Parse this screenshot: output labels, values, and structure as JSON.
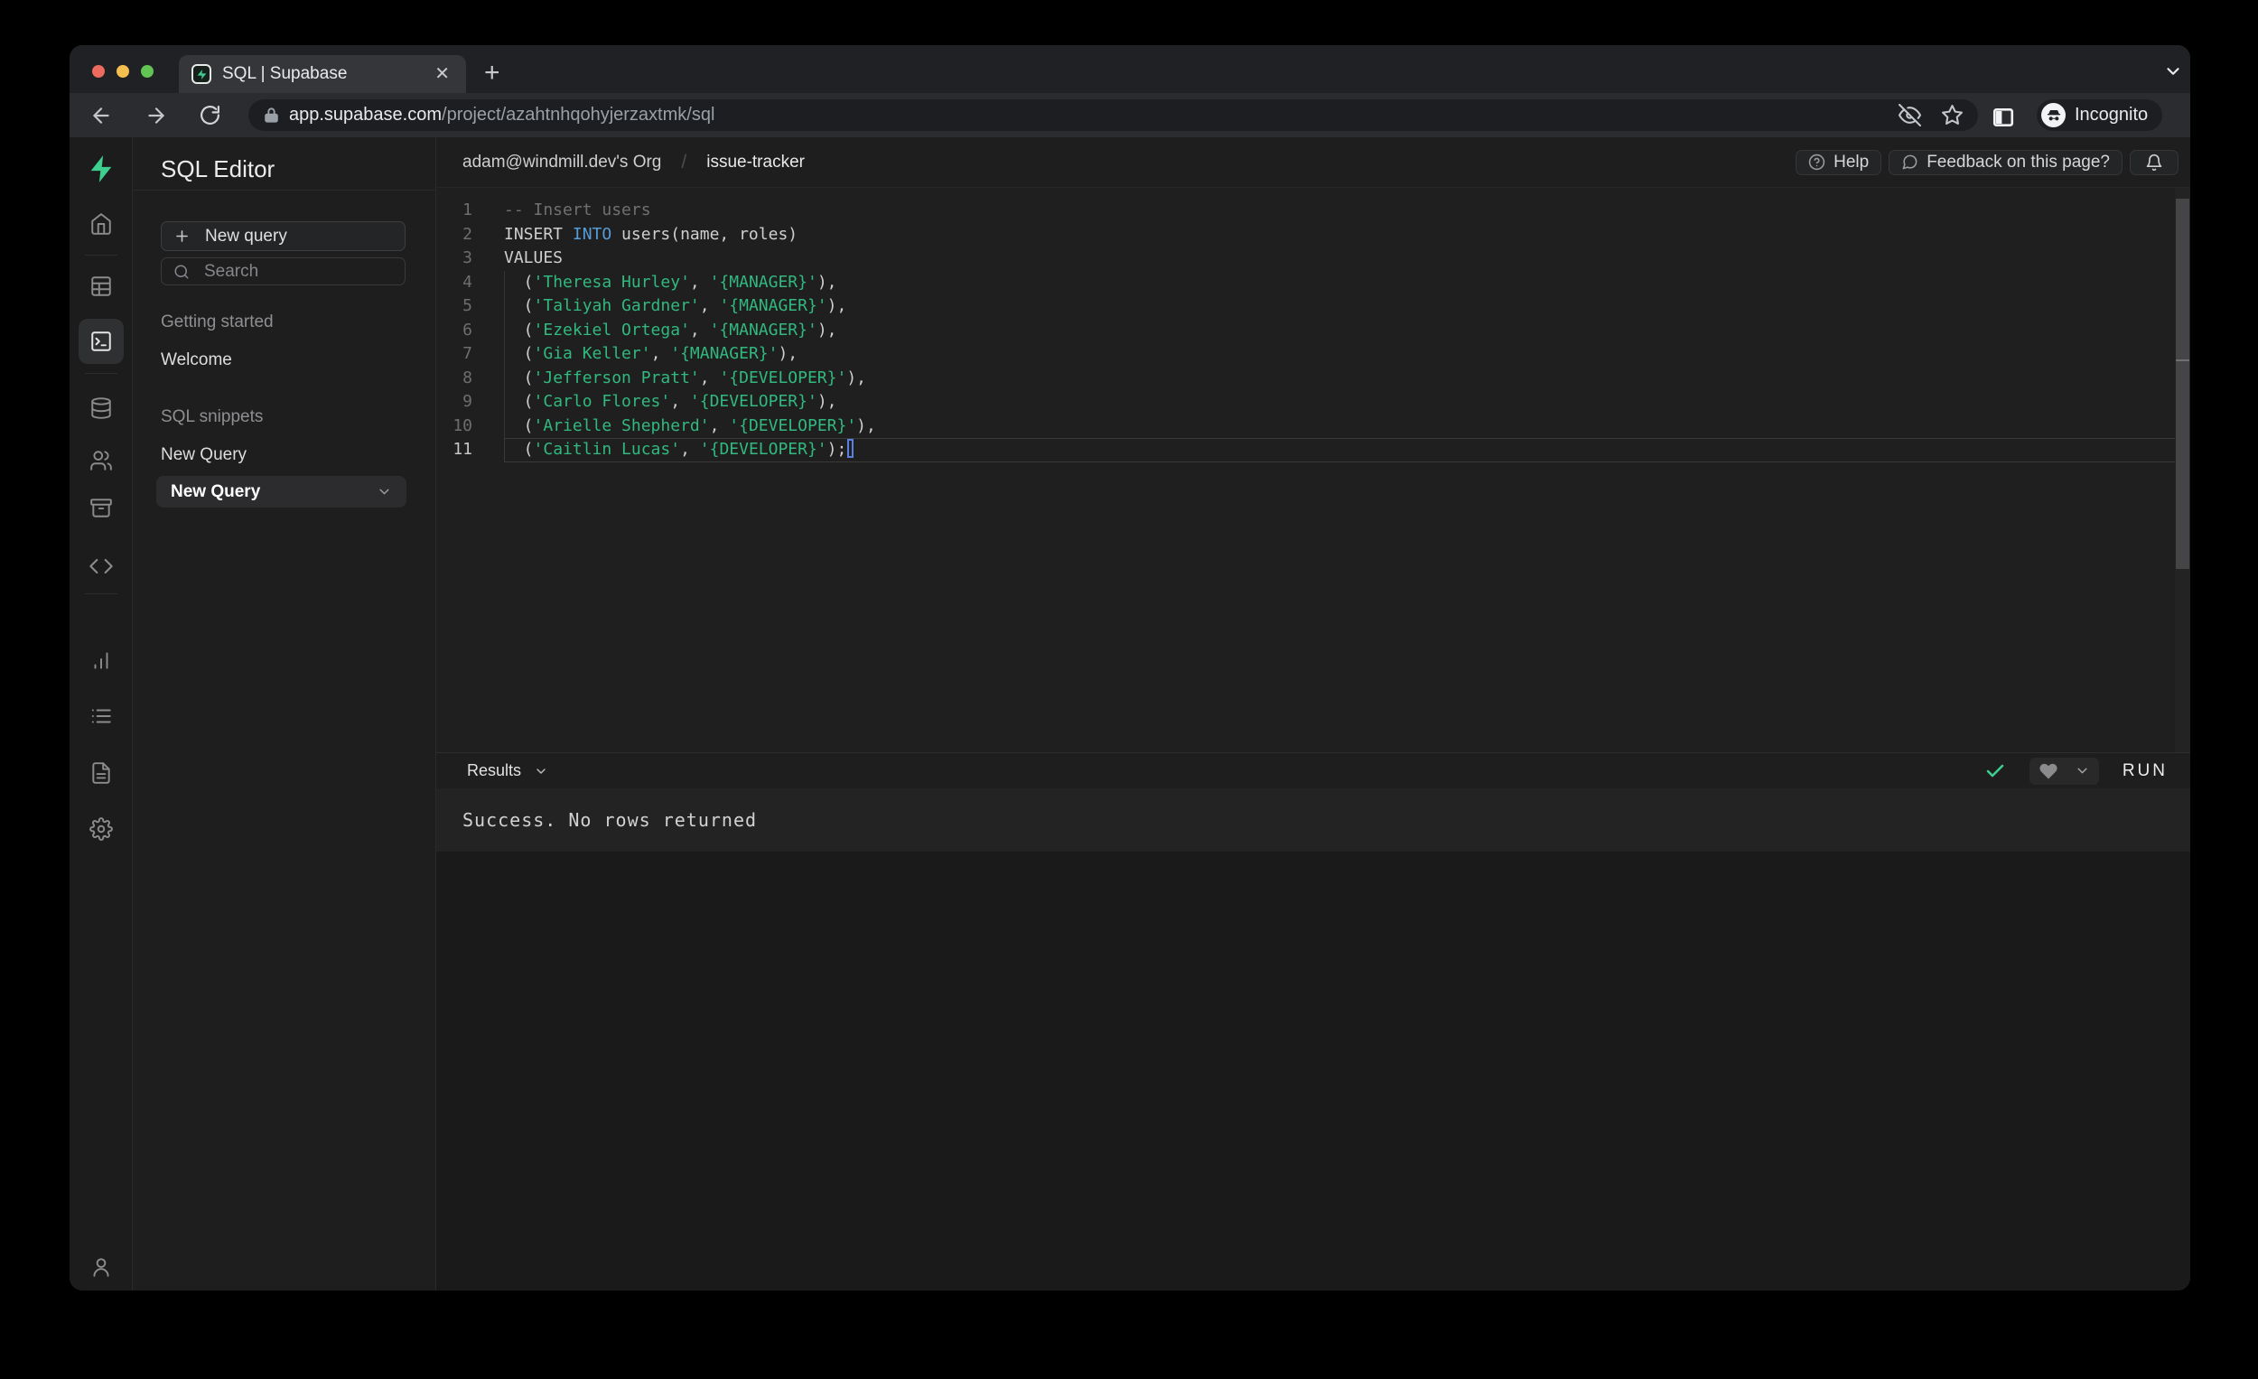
{
  "browser": {
    "tab_title": "SQL | Supabase",
    "url_host": "app.supabase.com",
    "url_path": "/project/azahtnhqohyjerzaxtmk/sql",
    "incognito_label": "Incognito"
  },
  "colors": {
    "brand_green": "#3ECF8E",
    "keyword_blue": "#569cd6",
    "string_green": "#31b97f",
    "traffic_red": "#EC6A5E",
    "traffic_yellow": "#F5BF4F",
    "traffic_green": "#61C454",
    "check_green": "#3ECF8E"
  },
  "icons": {
    "rail": [
      "supabase-logo",
      "home-icon",
      "table-editor-icon",
      "sql-editor-icon",
      "database-icon",
      "auth-users-icon",
      "storage-icon",
      "functions-code-icon",
      "reports-icon",
      "logs-icon",
      "docs-icon",
      "settings-gear-icon",
      "account-user-icon"
    ],
    "chrome": [
      "back-icon",
      "forward-icon",
      "reload-icon",
      "lock-icon",
      "eye-off-icon",
      "star-icon",
      "side-panel-icon",
      "incognito-icon",
      "kebab-menu-icon",
      "tab-close-icon",
      "new-tab-icon",
      "chevron-down-icon"
    ]
  },
  "sidebar": {
    "title": "SQL Editor",
    "new_query_button": "New query",
    "search_placeholder": "Search",
    "sections": {
      "getting_started": {
        "label": "Getting started",
        "items": [
          "Welcome"
        ]
      },
      "sql_snippets": {
        "label": "SQL snippets",
        "items": [
          "New Query",
          "New Query"
        ],
        "selected": "New Query"
      }
    }
  },
  "header": {
    "breadcrumb": {
      "org": "adam@windmill.dev's Org",
      "separator": "/",
      "project": "issue-tracker"
    },
    "help_button": "Help",
    "feedback_button": "Feedback on this page?"
  },
  "editor": {
    "active_line": 11,
    "lines": [
      {
        "tokens": [
          {
            "t": "-- Insert users",
            "c": "cm"
          }
        ]
      },
      {
        "tokens": [
          {
            "t": "INSERT ",
            "c": "tx"
          },
          {
            "t": "INTO",
            "c": "kw"
          },
          {
            "t": " users(name, roles)",
            "c": "tx"
          }
        ]
      },
      {
        "tokens": [
          {
            "t": "VALUES",
            "c": "tx"
          }
        ]
      },
      {
        "guide": true,
        "tokens": [
          {
            "t": "  (",
            "c": "tx"
          },
          {
            "t": "'Theresa Hurley'",
            "c": "st"
          },
          {
            "t": ", ",
            "c": "tx"
          },
          {
            "t": "'{MANAGER}'",
            "c": "st"
          },
          {
            "t": "),",
            "c": "tx"
          }
        ]
      },
      {
        "guide": true,
        "tokens": [
          {
            "t": "  (",
            "c": "tx"
          },
          {
            "t": "'Taliyah Gardner'",
            "c": "st"
          },
          {
            "t": ", ",
            "c": "tx"
          },
          {
            "t": "'{MANAGER}'",
            "c": "st"
          },
          {
            "t": "),",
            "c": "tx"
          }
        ]
      },
      {
        "guide": true,
        "tokens": [
          {
            "t": "  (",
            "c": "tx"
          },
          {
            "t": "'Ezekiel Ortega'",
            "c": "st"
          },
          {
            "t": ", ",
            "c": "tx"
          },
          {
            "t": "'{MANAGER}'",
            "c": "st"
          },
          {
            "t": "),",
            "c": "tx"
          }
        ]
      },
      {
        "guide": true,
        "tokens": [
          {
            "t": "  (",
            "c": "tx"
          },
          {
            "t": "'Gia Keller'",
            "c": "st"
          },
          {
            "t": ", ",
            "c": "tx"
          },
          {
            "t": "'{MANAGER}'",
            "c": "st"
          },
          {
            "t": "),",
            "c": "tx"
          }
        ]
      },
      {
        "guide": true,
        "tokens": [
          {
            "t": "  (",
            "c": "tx"
          },
          {
            "t": "'Jefferson Pratt'",
            "c": "st"
          },
          {
            "t": ", ",
            "c": "tx"
          },
          {
            "t": "'{DEVELOPER}'",
            "c": "st"
          },
          {
            "t": "),",
            "c": "tx"
          }
        ]
      },
      {
        "guide": true,
        "tokens": [
          {
            "t": "  (",
            "c": "tx"
          },
          {
            "t": "'Carlo Flores'",
            "c": "st"
          },
          {
            "t": ", ",
            "c": "tx"
          },
          {
            "t": "'{DEVELOPER}'",
            "c": "st"
          },
          {
            "t": "),",
            "c": "tx"
          }
        ]
      },
      {
        "guide": true,
        "tokens": [
          {
            "t": "  (",
            "c": "tx"
          },
          {
            "t": "'Arielle Shepherd'",
            "c": "st"
          },
          {
            "t": ", ",
            "c": "tx"
          },
          {
            "t": "'{DEVELOPER}'",
            "c": "st"
          },
          {
            "t": "),",
            "c": "tx"
          }
        ]
      },
      {
        "guide": true,
        "tokens": [
          {
            "t": "  (",
            "c": "tx"
          },
          {
            "t": "'Caitlin Lucas'",
            "c": "st"
          },
          {
            "t": ", ",
            "c": "tx"
          },
          {
            "t": "'{DEVELOPER}'",
            "c": "st"
          },
          {
            "t": ");",
            "c": "tx"
          }
        ]
      }
    ]
  },
  "results": {
    "label": "Results",
    "run_button": "RUN",
    "status_message": "Success. No rows returned"
  }
}
